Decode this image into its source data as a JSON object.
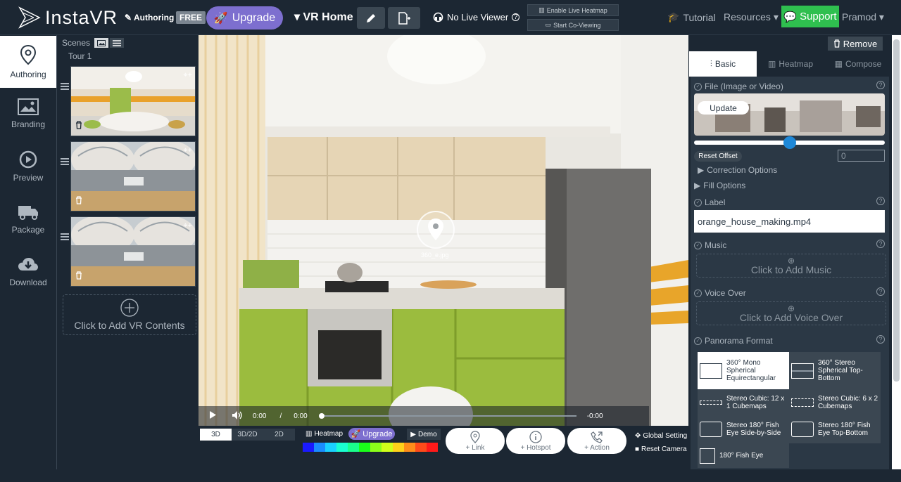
{
  "app": {
    "logo": "InstaVR",
    "mode": "Authoring",
    "plan": "FREE",
    "upgrade": "Upgrade",
    "project": "VR Home"
  },
  "top": {
    "live_viewer": "No Live Viewer",
    "enable_heatmap": "Enable Live Heatmap",
    "start_coviewing": "Start Co-Viewing",
    "tutorial": "Tutorial",
    "resources": "Resources",
    "support": "Support",
    "user": "Pramod"
  },
  "leftnav": {
    "items": [
      {
        "label": "Authoring",
        "icon": "location-pin-icon"
      },
      {
        "label": "Branding",
        "icon": "image-icon"
      },
      {
        "label": "Preview",
        "icon": "play-circle-icon"
      },
      {
        "label": "Package",
        "icon": "truck-icon"
      },
      {
        "label": "Download",
        "icon": "cloud-download-icon"
      }
    ]
  },
  "scenes": {
    "title": "Scenes",
    "tour": "Tour 1",
    "add_content": "Click to Add VR Contents"
  },
  "viewer": {
    "hotspot_label": "360_e.jpg"
  },
  "player": {
    "current": "0:00",
    "sep": "/",
    "duration": "0:00",
    "remaining": "-0:00",
    "progress": 0
  },
  "bottom": {
    "tabs": [
      "3D",
      "3D/2D",
      "2D"
    ],
    "heatmap": "Heatmap",
    "upgrade": "Upgrade",
    "demo": "Demo",
    "link": "+ Link",
    "hotspot": "+ Hotspot",
    "action": "+ Action",
    "global_setting": "Global Setting",
    "reset_camera": "Reset Camera",
    "heat_colors": [
      "#1a1aff",
      "#1a8cff",
      "#1ad1ff",
      "#1affd1",
      "#1aff8c",
      "#1aff1a",
      "#8cff1a",
      "#d1ff1a",
      "#ffd11a",
      "#ff8c1a",
      "#ff4a1a",
      "#ff1a1a"
    ]
  },
  "right": {
    "remove": "Remove",
    "tabs": [
      "Basic",
      "Heatmap",
      "Compose"
    ],
    "file_label": "File (Image or Video)",
    "update": "Update",
    "reset_offset": "Reset Offset",
    "offset_value": "0",
    "offset_fraction": 0.5,
    "correction": "Correction Options",
    "fill": "Fill Options",
    "label_title": "Label",
    "label_value": "orange_house_making.mp4",
    "music_title": "Music",
    "add_music": "Click to Add Music",
    "voice_title": "Voice Over",
    "add_voice": "Click to Add Voice Over",
    "pano_title": "Panorama Format",
    "pano_options": [
      "360° Mono Spherical Equirectangular",
      "360° Stereo Spherical Top-Bottom",
      "Stereo Cubic: 12 x 1 Cubemaps",
      "Stereo Cubic: 6 x 2 Cubemaps",
      "Stereo 180° Fish Eye Side-by-Side",
      "Stereo 180° Fish Eye Top-Bottom",
      "180° Fish Eye"
    ]
  }
}
